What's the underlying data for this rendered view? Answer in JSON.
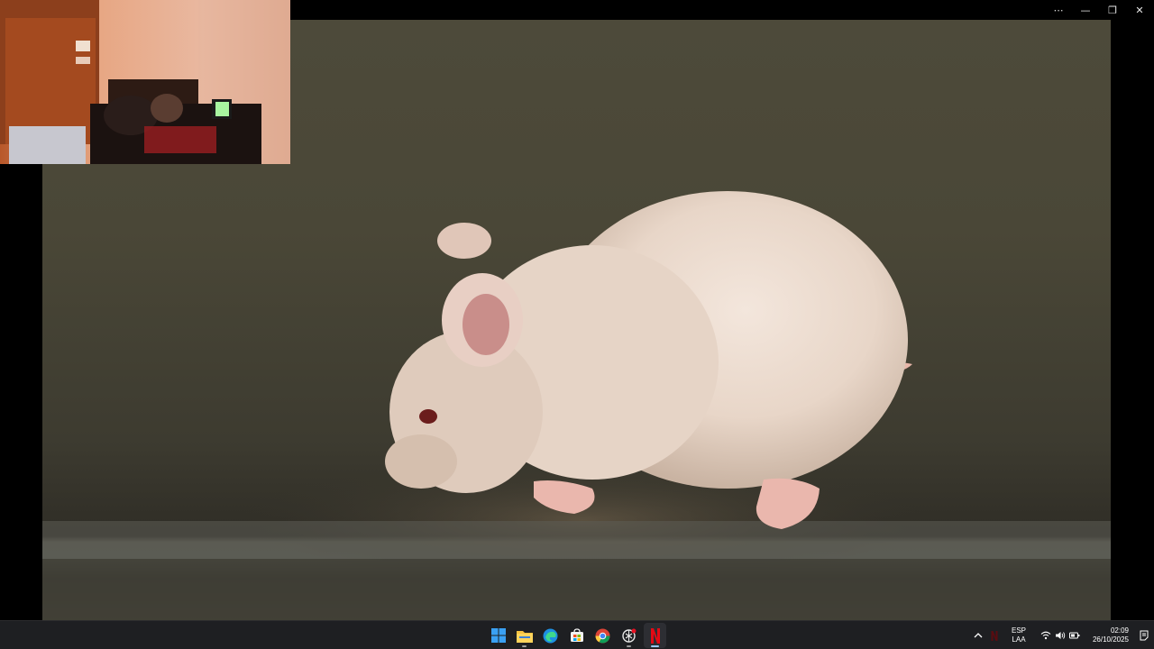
{
  "window": {
    "more_label": "⋯",
    "minimize_label": "—",
    "restore_label": "❐",
    "close_label": "✕"
  },
  "video": {
    "description_icon": "video-frame",
    "accent": "#e9ddd2"
  },
  "pip": {
    "icon": "camera-feed"
  },
  "taskbar": {
    "apps": [
      {
        "name": "start-icon"
      },
      {
        "name": "file-explorer-icon"
      },
      {
        "name": "edge-icon"
      },
      {
        "name": "store-icon"
      },
      {
        "name": "chrome-icon"
      },
      {
        "name": "openai-icon"
      },
      {
        "name": "netflix-icon"
      }
    ],
    "tray": {
      "chevron": "^",
      "language_line1": "ESP",
      "language_line2": "LAA",
      "time": "02:09",
      "date": "26/10/2025"
    }
  },
  "colors": {
    "taskbar_bg": "#1e1f22",
    "netflix_red": "#e50914",
    "windows_blue": "#3aa0f3"
  }
}
